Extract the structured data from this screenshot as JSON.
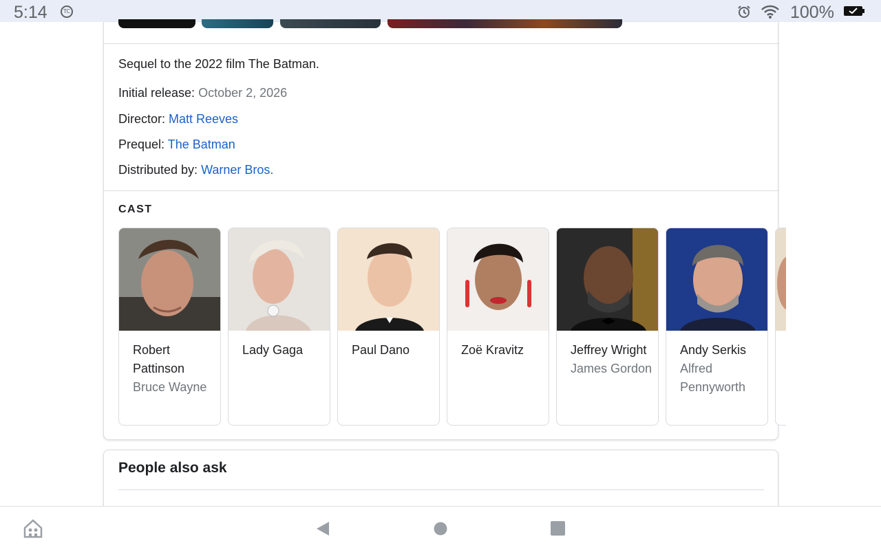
{
  "status_bar": {
    "time": "5:14",
    "badge": "TC",
    "battery_pct": "100%",
    "icons": [
      "alarm-icon",
      "wifi-icon",
      "battery-icon"
    ]
  },
  "knowledge_panel": {
    "description": "Sequel to the 2022 film The Batman.",
    "facts": [
      {
        "label": "Initial release: ",
        "value": "October 2, 2026",
        "style": "plain"
      },
      {
        "label": "Director: ",
        "value": "Matt Reeves",
        "style": "link"
      },
      {
        "label": "Prequel: ",
        "value": "The Batman",
        "style": "link"
      },
      {
        "label": "Distributed by: ",
        "value": "Warner Bros.",
        "style": "link"
      }
    ],
    "cast_heading": "CAST",
    "cast": [
      {
        "name": "Robert Pattinson",
        "role": "Bruce Wayne"
      },
      {
        "name": "Lady Gaga",
        "role": ""
      },
      {
        "name": "Paul Dano",
        "role": ""
      },
      {
        "name": "Zoë Kravitz",
        "role": ""
      },
      {
        "name": "Jeffrey Wright",
        "role": "James Gordon"
      },
      {
        "name": "Andy Serkis",
        "role": "Alfred Pennyworth"
      }
    ]
  },
  "people_also_ask": {
    "title": "People also ask"
  },
  "nav_bar": {
    "icons": [
      "home-assist-icon",
      "back-icon",
      "home-icon",
      "recents-icon"
    ]
  },
  "colors": {
    "link": "#1a62c9",
    "secondary_text": "#70757a",
    "status_bar_bg": "#e8edf7"
  }
}
